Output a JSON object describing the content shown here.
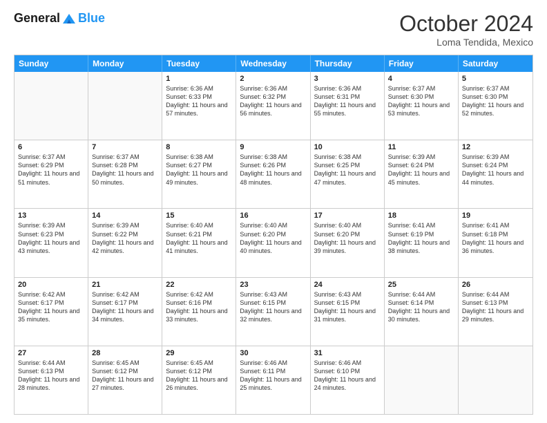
{
  "header": {
    "logo_line1": "General",
    "logo_line2": "Blue",
    "month_title": "October 2024",
    "location": "Loma Tendida, Mexico"
  },
  "weekdays": [
    "Sunday",
    "Monday",
    "Tuesday",
    "Wednesday",
    "Thursday",
    "Friday",
    "Saturday"
  ],
  "rows": [
    [
      {
        "day": "",
        "empty": true
      },
      {
        "day": "",
        "empty": true
      },
      {
        "day": "1",
        "sunrise": "Sunrise: 6:36 AM",
        "sunset": "Sunset: 6:33 PM",
        "daylight": "Daylight: 11 hours and 57 minutes."
      },
      {
        "day": "2",
        "sunrise": "Sunrise: 6:36 AM",
        "sunset": "Sunset: 6:32 PM",
        "daylight": "Daylight: 11 hours and 56 minutes."
      },
      {
        "day": "3",
        "sunrise": "Sunrise: 6:36 AM",
        "sunset": "Sunset: 6:31 PM",
        "daylight": "Daylight: 11 hours and 55 minutes."
      },
      {
        "day": "4",
        "sunrise": "Sunrise: 6:37 AM",
        "sunset": "Sunset: 6:30 PM",
        "daylight": "Daylight: 11 hours and 53 minutes."
      },
      {
        "day": "5",
        "sunrise": "Sunrise: 6:37 AM",
        "sunset": "Sunset: 6:30 PM",
        "daylight": "Daylight: 11 hours and 52 minutes."
      }
    ],
    [
      {
        "day": "6",
        "sunrise": "Sunrise: 6:37 AM",
        "sunset": "Sunset: 6:29 PM",
        "daylight": "Daylight: 11 hours and 51 minutes."
      },
      {
        "day": "7",
        "sunrise": "Sunrise: 6:37 AM",
        "sunset": "Sunset: 6:28 PM",
        "daylight": "Daylight: 11 hours and 50 minutes."
      },
      {
        "day": "8",
        "sunrise": "Sunrise: 6:38 AM",
        "sunset": "Sunset: 6:27 PM",
        "daylight": "Daylight: 11 hours and 49 minutes."
      },
      {
        "day": "9",
        "sunrise": "Sunrise: 6:38 AM",
        "sunset": "Sunset: 6:26 PM",
        "daylight": "Daylight: 11 hours and 48 minutes."
      },
      {
        "day": "10",
        "sunrise": "Sunrise: 6:38 AM",
        "sunset": "Sunset: 6:25 PM",
        "daylight": "Daylight: 11 hours and 47 minutes."
      },
      {
        "day": "11",
        "sunrise": "Sunrise: 6:39 AM",
        "sunset": "Sunset: 6:24 PM",
        "daylight": "Daylight: 11 hours and 45 minutes."
      },
      {
        "day": "12",
        "sunrise": "Sunrise: 6:39 AM",
        "sunset": "Sunset: 6:24 PM",
        "daylight": "Daylight: 11 hours and 44 minutes."
      }
    ],
    [
      {
        "day": "13",
        "sunrise": "Sunrise: 6:39 AM",
        "sunset": "Sunset: 6:23 PM",
        "daylight": "Daylight: 11 hours and 43 minutes."
      },
      {
        "day": "14",
        "sunrise": "Sunrise: 6:39 AM",
        "sunset": "Sunset: 6:22 PM",
        "daylight": "Daylight: 11 hours and 42 minutes."
      },
      {
        "day": "15",
        "sunrise": "Sunrise: 6:40 AM",
        "sunset": "Sunset: 6:21 PM",
        "daylight": "Daylight: 11 hours and 41 minutes."
      },
      {
        "day": "16",
        "sunrise": "Sunrise: 6:40 AM",
        "sunset": "Sunset: 6:20 PM",
        "daylight": "Daylight: 11 hours and 40 minutes."
      },
      {
        "day": "17",
        "sunrise": "Sunrise: 6:40 AM",
        "sunset": "Sunset: 6:20 PM",
        "daylight": "Daylight: 11 hours and 39 minutes."
      },
      {
        "day": "18",
        "sunrise": "Sunrise: 6:41 AM",
        "sunset": "Sunset: 6:19 PM",
        "daylight": "Daylight: 11 hours and 38 minutes."
      },
      {
        "day": "19",
        "sunrise": "Sunrise: 6:41 AM",
        "sunset": "Sunset: 6:18 PM",
        "daylight": "Daylight: 11 hours and 36 minutes."
      }
    ],
    [
      {
        "day": "20",
        "sunrise": "Sunrise: 6:42 AM",
        "sunset": "Sunset: 6:17 PM",
        "daylight": "Daylight: 11 hours and 35 minutes."
      },
      {
        "day": "21",
        "sunrise": "Sunrise: 6:42 AM",
        "sunset": "Sunset: 6:17 PM",
        "daylight": "Daylight: 11 hours and 34 minutes."
      },
      {
        "day": "22",
        "sunrise": "Sunrise: 6:42 AM",
        "sunset": "Sunset: 6:16 PM",
        "daylight": "Daylight: 11 hours and 33 minutes."
      },
      {
        "day": "23",
        "sunrise": "Sunrise: 6:43 AM",
        "sunset": "Sunset: 6:15 PM",
        "daylight": "Daylight: 11 hours and 32 minutes."
      },
      {
        "day": "24",
        "sunrise": "Sunrise: 6:43 AM",
        "sunset": "Sunset: 6:15 PM",
        "daylight": "Daylight: 11 hours and 31 minutes."
      },
      {
        "day": "25",
        "sunrise": "Sunrise: 6:44 AM",
        "sunset": "Sunset: 6:14 PM",
        "daylight": "Daylight: 11 hours and 30 minutes."
      },
      {
        "day": "26",
        "sunrise": "Sunrise: 6:44 AM",
        "sunset": "Sunset: 6:13 PM",
        "daylight": "Daylight: 11 hours and 29 minutes."
      }
    ],
    [
      {
        "day": "27",
        "sunrise": "Sunrise: 6:44 AM",
        "sunset": "Sunset: 6:13 PM",
        "daylight": "Daylight: 11 hours and 28 minutes."
      },
      {
        "day": "28",
        "sunrise": "Sunrise: 6:45 AM",
        "sunset": "Sunset: 6:12 PM",
        "daylight": "Daylight: 11 hours and 27 minutes."
      },
      {
        "day": "29",
        "sunrise": "Sunrise: 6:45 AM",
        "sunset": "Sunset: 6:12 PM",
        "daylight": "Daylight: 11 hours and 26 minutes."
      },
      {
        "day": "30",
        "sunrise": "Sunrise: 6:46 AM",
        "sunset": "Sunset: 6:11 PM",
        "daylight": "Daylight: 11 hours and 25 minutes."
      },
      {
        "day": "31",
        "sunrise": "Sunrise: 6:46 AM",
        "sunset": "Sunset: 6:10 PM",
        "daylight": "Daylight: 11 hours and 24 minutes."
      },
      {
        "day": "",
        "empty": true
      },
      {
        "day": "",
        "empty": true
      }
    ]
  ]
}
